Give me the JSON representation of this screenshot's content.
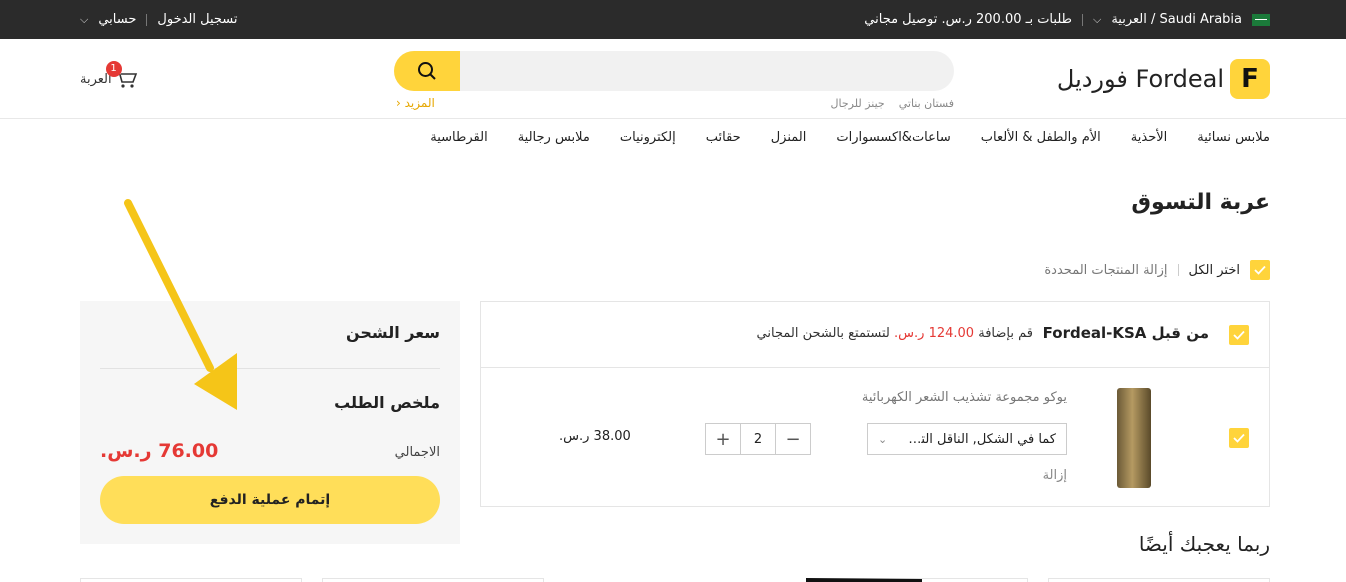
{
  "topbar": {
    "region": "Saudi Arabia / العربية",
    "shipping_promo": "طلبات بـ 200.00 ر.س. توصيل مجاني",
    "login": "تسجيل الدخول",
    "account": "حسابي"
  },
  "header": {
    "logo_letter": "F",
    "logo_text": "فورديل Fordeal",
    "search": {
      "placeholder": "",
      "hotwords": [
        "فستان بناتي",
        "جينز للرجال"
      ],
      "more": "المزيد"
    },
    "cart": {
      "label": "العربة",
      "count": "1"
    }
  },
  "nav": {
    "items": [
      "ملابس نسائية",
      "الأحذية",
      "الأم والطفل & الألعاب",
      "ساعات&اكسسوارات",
      "المنزل",
      "حقائب",
      "إلكترونيات",
      "ملابس رجالية",
      "القرطاسية"
    ]
  },
  "cart_page": {
    "title": "عربة التسوق",
    "select_all": "اختر الكل",
    "remove_selected": "إزالة المنتجات المحددة",
    "seller": {
      "name": "من قبل Fordeal-KSA",
      "promo_prefix": "قم بإضافة",
      "promo_amount": "124.00 ر.س.",
      "promo_suffix": "لتستمتع بالشحن المجاني"
    },
    "item": {
      "name": "يوكو مجموعة تشذيب الشعر الكهربائية",
      "variant": "كما في الشكل, الناقل التسلسلي",
      "quantity": "2",
      "price": "38.00 ر.س.",
      "remove": "إزالة"
    }
  },
  "summary": {
    "shipping_title": "سعر الشحن",
    "order_title": "ملخص الطلب",
    "total_label": "الاجمالي",
    "total_value": "76.00 ر.س.",
    "checkout": "إتمام عملية الدفع"
  },
  "recommendations": {
    "title": "ربما يعجبك أيضًا"
  },
  "colors": {
    "accent": "#ffd43b",
    "price_red": "#e53935",
    "arrow": "#f5c518"
  }
}
